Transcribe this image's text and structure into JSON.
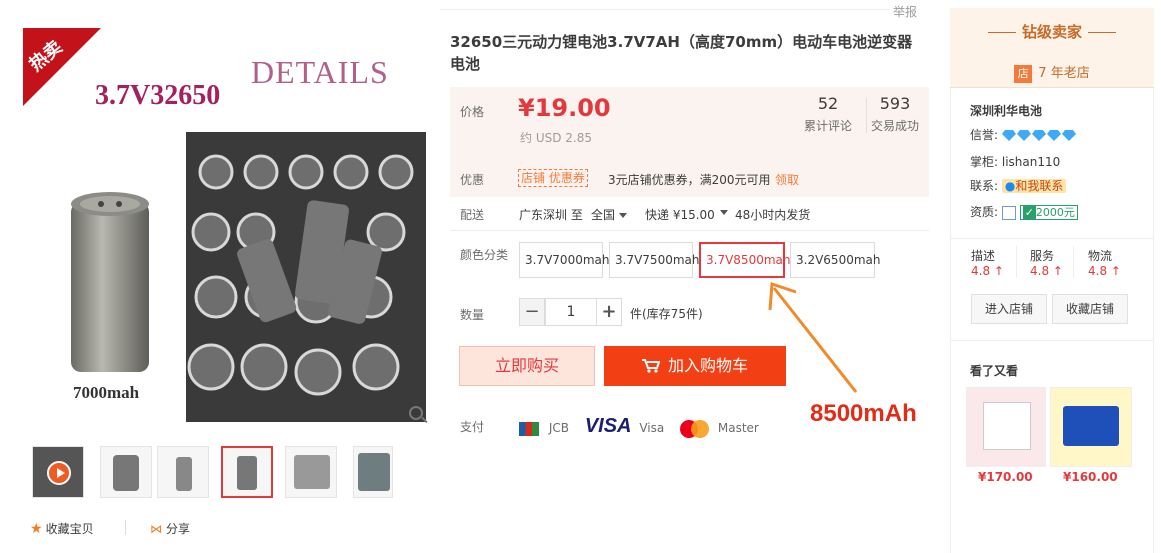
{
  "report": "举报",
  "product": {
    "title": "32650三元动力锂电池3.7V7AH（高度70mm）电动车电池逆变器电池",
    "image": {
      "hot_badge": "热卖",
      "model": "3.7V32650",
      "details": "DETAILS",
      "caption": "7000mah"
    },
    "price_label": "价格",
    "price": "¥19.00",
    "price_usd": "约 USD 2.85",
    "reviews": {
      "count": "52",
      "label": "累计评论"
    },
    "sales": {
      "count": "593",
      "label": "交易成功"
    },
    "promo": {
      "label": "优惠",
      "tag": "店铺 优惠券",
      "text": "3元店铺优惠券，满200元可用",
      "link": "领取"
    },
    "shipping": {
      "label": "配送",
      "from": "广东深圳 至",
      "to": "全国",
      "method": "快递 ¥15.00",
      "time": "48小时内发货"
    },
    "color": {
      "label": "颜色分类",
      "options": [
        "3.7V7000mah",
        "3.7V7500mah",
        "3.7V8500mah",
        "3.2V6500mah"
      ],
      "selected": "3.7V8500mah"
    },
    "quantity": {
      "label": "数量",
      "value": "1",
      "minus": "−",
      "plus": "+",
      "stock": "件(库存75件)"
    },
    "buy_now": "立即购买",
    "add_cart": "加入购物车",
    "payment": {
      "label": "支付",
      "jcb": "JCB",
      "visa_logo": "VISA",
      "visa": "Visa",
      "master": "Master"
    },
    "annotation": "8500mAh",
    "favorite": "收藏宝贝",
    "share": "分享"
  },
  "seller": {
    "badge": "钻级卖家",
    "years": "7 年老店",
    "store_icon": "店",
    "name": "深圳利华电池",
    "credit_label": "信誉:",
    "owner_label": "掌柜:",
    "owner": "lishan110",
    "contact_label": "联系:",
    "contact": "和我联系",
    "qual_label": "资质:",
    "deposit": "2000元",
    "ratings": [
      {
        "label": "描述",
        "value": "4.8"
      },
      {
        "label": "服务",
        "value": "4.8"
      },
      {
        "label": "物流",
        "value": "4.8"
      }
    ],
    "enter_store": "进入店铺",
    "fav_store": "收藏店铺",
    "seen_title": "看了又看",
    "recs": [
      {
        "price": "¥170.00"
      },
      {
        "price": "¥160.00"
      }
    ]
  },
  "colors": {
    "accent": "#e4393c",
    "cart": "#f23f13",
    "orange": "#f57a3a"
  }
}
